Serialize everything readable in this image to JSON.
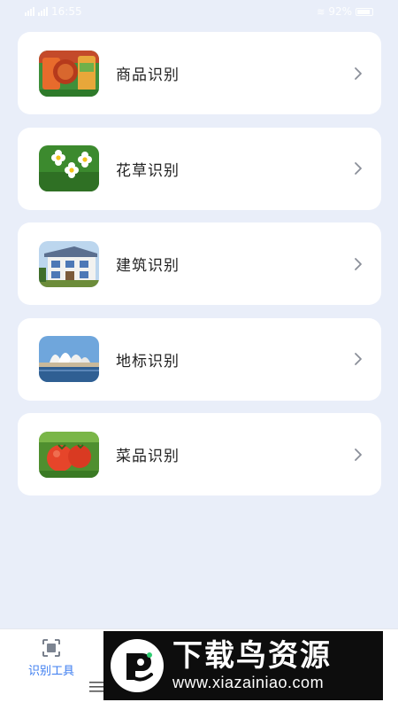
{
  "status_bar": {
    "time": "16:55",
    "battery": "92%"
  },
  "items": [
    {
      "label": "商品识别",
      "icon": "products-thumbnail"
    },
    {
      "label": "花草识别",
      "icon": "flowers-thumbnail"
    },
    {
      "label": "建筑识别",
      "icon": "building-thumbnail"
    },
    {
      "label": "地标识别",
      "icon": "landmark-thumbnail"
    },
    {
      "label": "菜品识别",
      "icon": "vegetables-thumbnail"
    }
  ],
  "bottom_nav": {
    "tools_label": "识别工具",
    "tools_icon": "scan-icon",
    "active_color": "#3b7cf0"
  },
  "watermark": {
    "title": "下载鸟资源",
    "url": "www.xiazainiao.com"
  },
  "colors": {
    "background": "#e9eef9",
    "card": "#ffffff",
    "accent": "#3b7cf0"
  }
}
